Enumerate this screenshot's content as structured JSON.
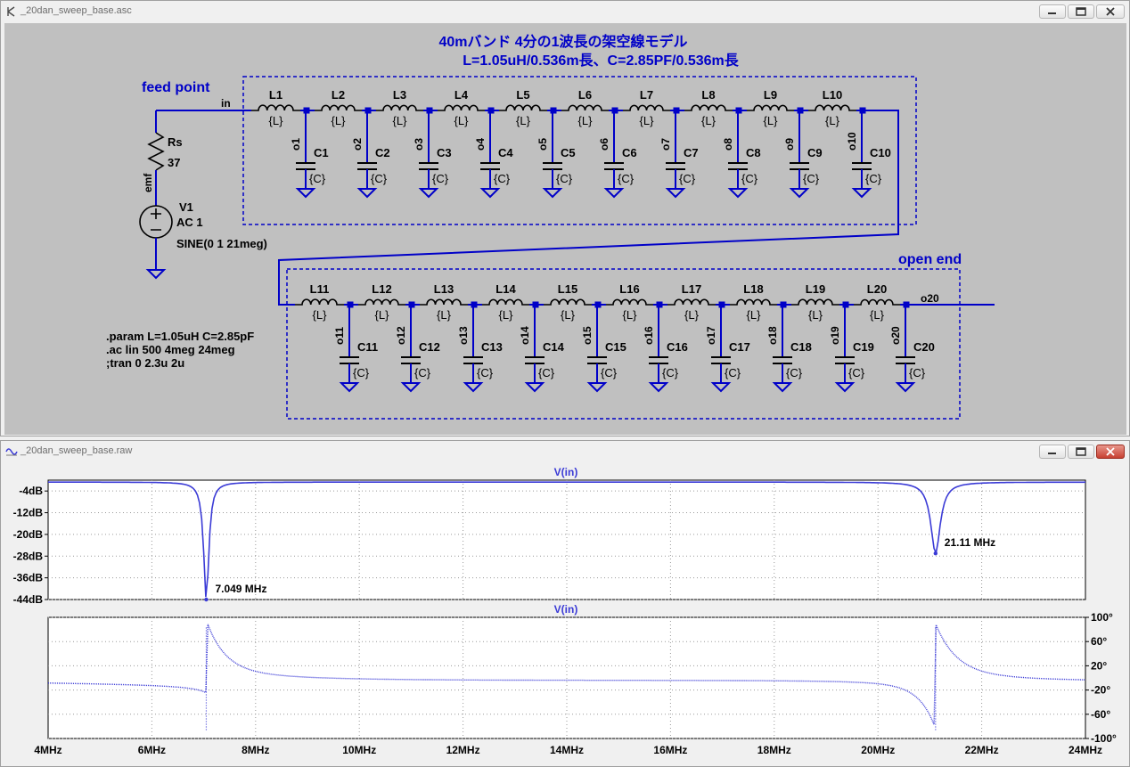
{
  "schematic_window": {
    "title": "_20dan_sweep_base.asc",
    "heading_line1": "40mバンド 4分の1波長の架空線モデル",
    "heading_line2": "L=1.05uH/0.536m長、C=2.85PF/0.536m長",
    "label_feed": "feed point",
    "label_open": "open end",
    "net_in": "in",
    "net_out": "o20",
    "net_emf": "emf",
    "rs_name": "Rs",
    "rs_value": "37",
    "v1_name": "V1",
    "v1_ac": "AC 1",
    "v1_sine": "SINE(0 1 21meg)",
    "directive1": ".param L=1.05uH C=2.85pF",
    "directive2": ".ac lin 500 4meg 24meg",
    "directive3": ";tran 0 2.3u 2u",
    "inductor_value": "{L}",
    "cap_value": "{C}",
    "inductor_prefix": "L",
    "cap_prefix": "C",
    "node_prefix": "o",
    "accent_color": "#0000c8"
  },
  "plot_window": {
    "title": "_20dan_sweep_base.raw",
    "trace_color": "#3b3bd6",
    "chart_data": [
      {
        "type": "line",
        "title": "V(in)",
        "x_ticks": [
          "4MHz",
          "6MHz",
          "8MHz",
          "10MHz",
          "12MHz",
          "14MHz",
          "16MHz",
          "18MHz",
          "20MHz",
          "22MHz",
          "24MHz"
        ],
        "xlim": [
          4,
          24
        ],
        "ylim": [
          -44,
          0
        ],
        "y_ticks": [
          "-4dB",
          "-12dB",
          "-20dB",
          "-28dB",
          "-36dB",
          "-44dB"
        ],
        "y_tick_values": [
          -4,
          -12,
          -20,
          -28,
          -36,
          -44
        ],
        "annotations": [
          {
            "text": "7.049 MHz",
            "x": 7.049,
            "y": -44
          },
          {
            "text": "21.11 MHz",
            "x": 21.11,
            "y": -27
          }
        ],
        "resonances": [
          {
            "f0": 7.049,
            "width": 0.06,
            "depth": -44
          },
          {
            "f0": 21.11,
            "width": 0.11,
            "depth": -27
          }
        ],
        "baseline": -0.7
      },
      {
        "type": "line",
        "title": "V(in)",
        "ylim": [
          -100,
          100
        ],
        "y_ticks": [
          "100°",
          "60°",
          "20°",
          "-20°",
          "-60°",
          "-100°"
        ],
        "y_tick_values": [
          100,
          60,
          20,
          -20,
          -60,
          -100
        ],
        "resonances": [
          {
            "f0": 7.049,
            "amp": 86
          },
          {
            "f0": 21.11,
            "amp": 86
          }
        ]
      }
    ]
  }
}
